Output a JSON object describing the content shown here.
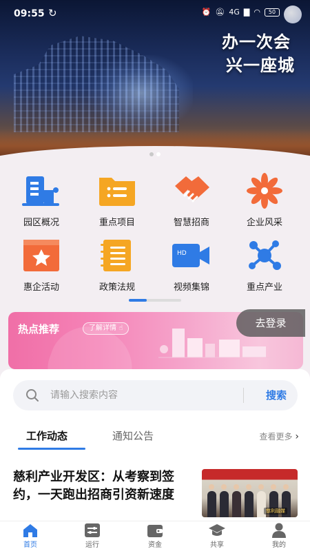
{
  "status_bar": {
    "time": "09:55",
    "network": "4G",
    "battery": "50"
  },
  "hero": {
    "slogan_line1": "办一次会",
    "slogan_line2": "兴一座城",
    "slides": 2,
    "active_slide": 2
  },
  "grid": {
    "items": [
      {
        "label": "园区概况",
        "icon": "building-icon",
        "color": "#2f7be5"
      },
      {
        "label": "重点项目",
        "icon": "folder-list-icon",
        "color": "#f5a623"
      },
      {
        "label": "智慧招商",
        "icon": "handshake-icon",
        "color": "#f26b3a"
      },
      {
        "label": "企业风采",
        "icon": "flower-icon",
        "color": "#f26b3a"
      },
      {
        "label": "惠企活动",
        "icon": "star-card-icon",
        "color": "#f26b3a"
      },
      {
        "label": "政策法规",
        "icon": "notebook-icon",
        "color": "#f5a623"
      },
      {
        "label": "视频集锦",
        "icon": "video-camera-icon",
        "color": "#2f7be5"
      },
      {
        "label": "重点产业",
        "icon": "molecule-icon",
        "color": "#2f7be5"
      }
    ],
    "pager_pages": 2,
    "pager_active": 1
  },
  "promo": {
    "title": "热点推荐",
    "detail_button": "了解详情"
  },
  "login_button": "去登录",
  "search": {
    "placeholder": "请输入搜索内容",
    "button": "搜索"
  },
  "tabs": {
    "items": [
      "工作动态",
      "通知公告"
    ],
    "active": 0,
    "more": "查看更多"
  },
  "news": {
    "title": "慈利产业开发区：从考察到签约，一天跑出招商引资新速度",
    "thumb_stamp": "慈利融媒"
  },
  "bottom_nav": {
    "items": [
      {
        "label": "首页",
        "icon": "home-icon"
      },
      {
        "label": "运行",
        "icon": "toggle-icon"
      },
      {
        "label": "资金",
        "icon": "wallet-icon"
      },
      {
        "label": "共享",
        "icon": "graduation-cap-icon"
      },
      {
        "label": "我的",
        "icon": "person-icon"
      }
    ],
    "active": 0
  },
  "colors": {
    "accent": "#2f7be5",
    "orange": "#f26b3a",
    "yellow": "#f5a623",
    "promo_pink": "#f06fa7"
  }
}
